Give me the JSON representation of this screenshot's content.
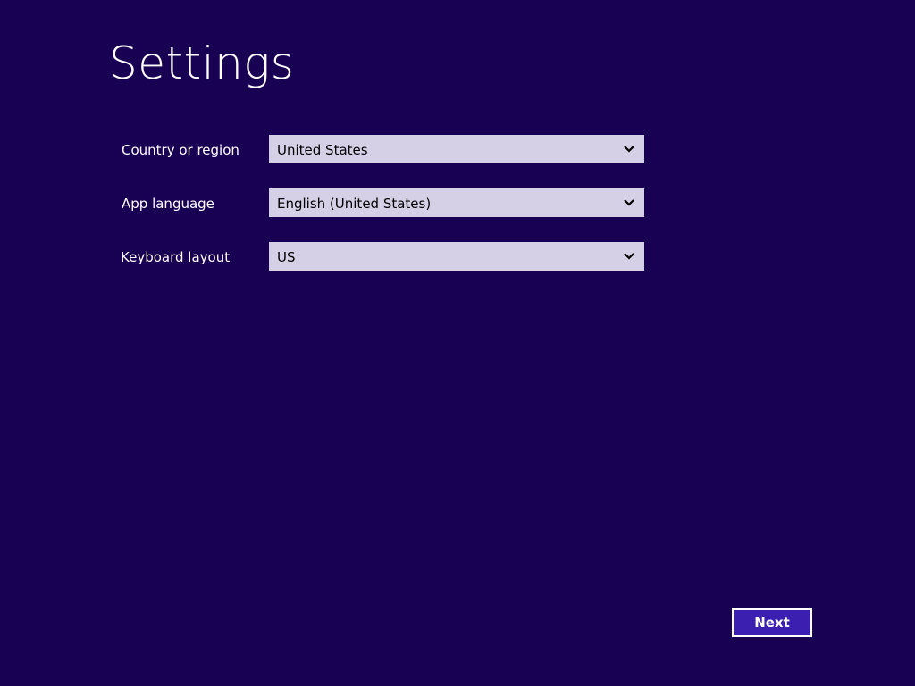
{
  "page": {
    "title": "Settings"
  },
  "fields": [
    {
      "label": "Country or region",
      "value": "United States"
    },
    {
      "label": "App language",
      "value": "English (United States)"
    },
    {
      "label": "Keyboard layout",
      "value": "US"
    }
  ],
  "actions": {
    "next_label": "Next"
  },
  "icons": {
    "dropdown": "chevron-down-icon"
  },
  "colors": {
    "background": "#180052",
    "field_background": "#d6d0e6",
    "button_background": "#3a1fb0",
    "text": "#ffffff"
  }
}
